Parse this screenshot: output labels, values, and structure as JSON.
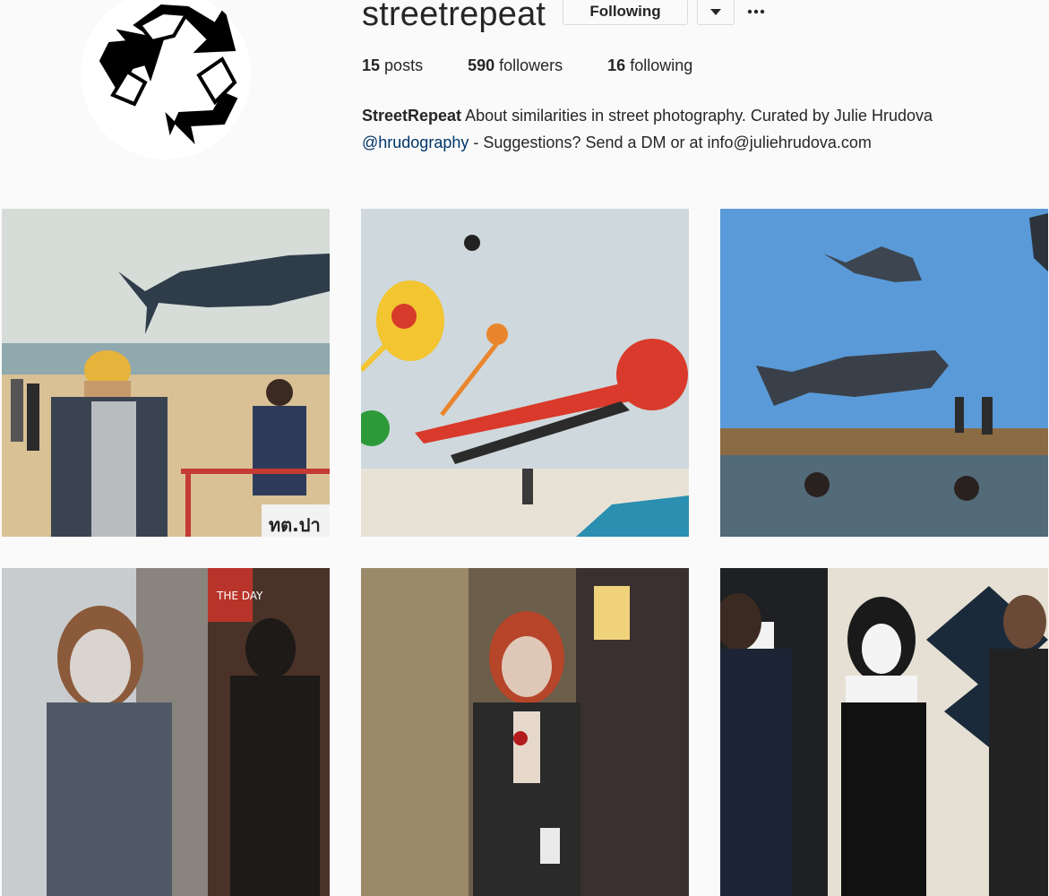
{
  "profile": {
    "username": "streetrepeat",
    "follow_button": "Following",
    "stats": {
      "posts_count": "15",
      "posts_label": "posts",
      "followers_count": "590",
      "followers_label": "followers",
      "following_count": "16",
      "following_label": "following"
    },
    "bio": {
      "name": "StreetRepeat",
      "text1": "About similarities in street photography. Curated by Julie Hrudova",
      "handle": "@hrudography",
      "text2": "- Suggestions? Send a DM or at info@juliehrudova.com"
    },
    "avatar_icon": "recycle-icon"
  },
  "posts": [
    {
      "sign_text": "ทต.ปา",
      "alt": "beach whale kite"
    },
    {
      "alt": "beach kites"
    },
    {
      "alt": "whale kites over water"
    },
    {
      "sign_text": "THE DAY",
      "alt": "zombie woman by window"
    },
    {
      "alt": "zombie woman in cafe"
    },
    {
      "alt": "nun costume"
    }
  ],
  "colors": {
    "background": "#fafafa",
    "text": "#262626",
    "link": "#003569",
    "border": "#dbdbdb"
  }
}
